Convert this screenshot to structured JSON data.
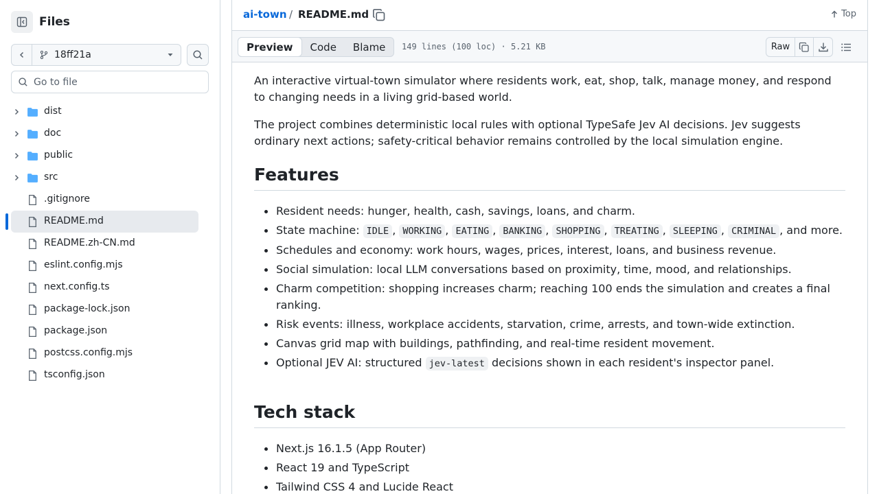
{
  "sidebar": {
    "title": "Files",
    "branch": "18ff21a",
    "goto_placeholder": "Go to file",
    "items": [
      {
        "label": "dist",
        "type": "folder"
      },
      {
        "label": "doc",
        "type": "folder"
      },
      {
        "label": "public",
        "type": "folder"
      },
      {
        "label": "src",
        "type": "folder"
      },
      {
        "label": ".gitignore",
        "type": "file"
      },
      {
        "label": "README.md",
        "type": "file",
        "active": true
      },
      {
        "label": "README.zh-CN.md",
        "type": "file"
      },
      {
        "label": "eslint.config.mjs",
        "type": "file"
      },
      {
        "label": "next.config.ts",
        "type": "file"
      },
      {
        "label": "package-lock.json",
        "type": "file"
      },
      {
        "label": "package.json",
        "type": "file"
      },
      {
        "label": "postcss.config.mjs",
        "type": "file"
      },
      {
        "label": "tsconfig.json",
        "type": "file"
      }
    ]
  },
  "header": {
    "repo": "ai-town",
    "separator": "/",
    "file": "README.md",
    "top_label": "Top"
  },
  "toolbar": {
    "tabs": [
      "Preview",
      "Code",
      "Blame"
    ],
    "active_tab": "Preview",
    "meta": "149 lines (100 loc) · 5.21 KB",
    "raw_label": "Raw"
  },
  "readme": {
    "p1": "An interactive virtual-town simulator where residents work, eat, shop, talk, manage money, and respond to changing needs in a living grid-based world.",
    "p2": "The project combines deterministic local rules with optional TypeSafe Jev AI decisions. Jev suggests ordinary next actions; safety-critical behavior remains controlled by the local simulation engine.",
    "features_heading": "Features",
    "f1": "Resident needs: hunger, health, cash, savings, loans, and charm.",
    "f2_prefix": "State machine: ",
    "states": [
      "IDLE",
      "WORKING",
      "EATING",
      "BANKING",
      "SHOPPING",
      "TREATING",
      "SLEEPING",
      "CRIMINAL"
    ],
    "f2_suffix": ", and more.",
    "f3": "Schedules and economy: work hours, wages, prices, interest, loans, and business revenue.",
    "f4": "Social simulation: local LLM conversations based on proximity, time, mood, and relationships.",
    "f5": "Charm competition: shopping increases charm; reaching 100 ends the simulation and creates a final ranking.",
    "f6": "Risk events: illness, workplace accidents, starvation, crime, arrests, and town-wide extinction.",
    "f7": "Canvas grid map with buildings, pathfinding, and real-time resident movement.",
    "f8_prefix": "Optional JEV AI: structured ",
    "f8_code": "jev-latest",
    "f8_suffix": " decisions shown in each resident's inspector panel.",
    "tech_heading": "Tech stack",
    "t1": "Next.js 16.1.5 (App Router)",
    "t2": "React 19 and TypeScript",
    "t3": "Tailwind CSS 4 and Lucide React"
  },
  "colors": {
    "accent": "#0969da",
    "folder": "#54aeff",
    "border": "#d1d9e0"
  }
}
